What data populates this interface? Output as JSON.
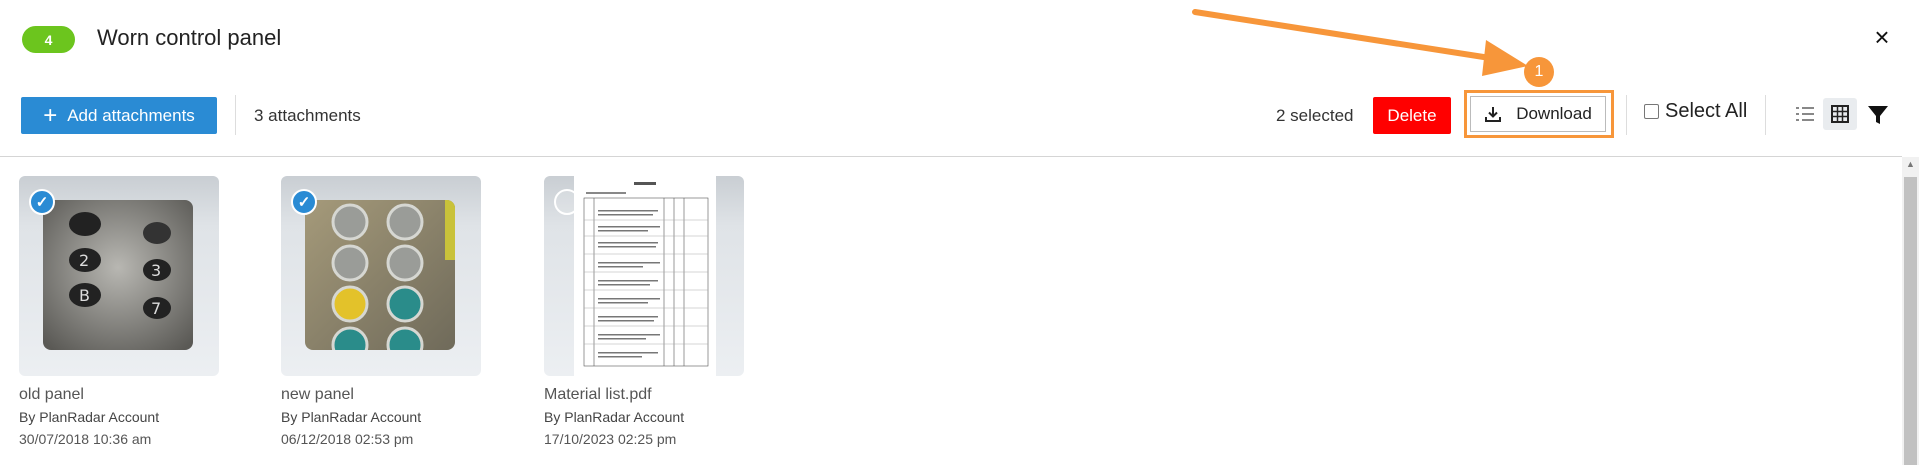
{
  "header": {
    "badge": "4",
    "title": "Worn control panel",
    "close_icon": "×"
  },
  "toolbar": {
    "add_label": "Add attachments",
    "attachment_count": "3 attachments",
    "selected_count": "2 selected",
    "delete_label": "Delete",
    "download_label": "Download",
    "select_all_label": "Select All"
  },
  "annotation": {
    "step_number": "1",
    "color": "#f7963a"
  },
  "colors": {
    "primary": "#2a8bd4",
    "danger": "#ff0000",
    "badge": "#6cc51e"
  },
  "attachments": [
    {
      "name": "old panel",
      "author": "By PlanRadar Account",
      "date": "30/07/2018 10:36 am",
      "selected": true
    },
    {
      "name": "new panel",
      "author": "By PlanRadar Account",
      "date": "06/12/2018 02:53 pm",
      "selected": true
    },
    {
      "name": "Material list.pdf",
      "author": "By PlanRadar Account",
      "date": "17/10/2023 02:25 pm",
      "selected": false
    }
  ]
}
